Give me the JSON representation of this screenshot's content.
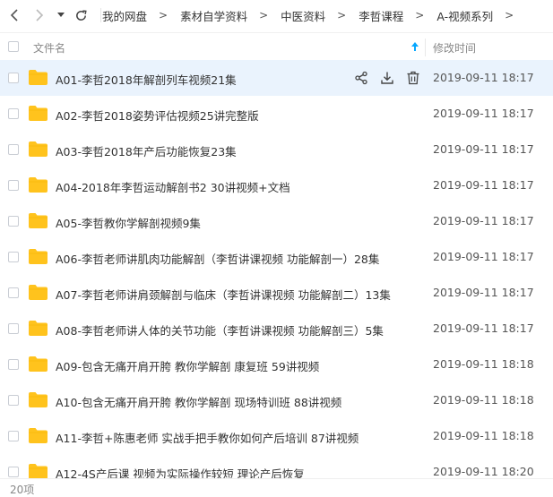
{
  "breadcrumb": [
    "我的网盘",
    "素材自学资料",
    "中医资料",
    "李哲课程",
    "A-视频系列"
  ],
  "breadcrumb_sep": ">",
  "columns": {
    "name": "文件名",
    "modified": "修改时间"
  },
  "files": [
    {
      "name": "A01-李哲2018年解剖列车视频21集",
      "modified": "2019-09-11 18:17"
    },
    {
      "name": "A02-李哲2018姿势评估视频25讲完整版",
      "modified": "2019-09-11 18:17"
    },
    {
      "name": "A03-李哲2018年产后功能恢复23集",
      "modified": "2019-09-11 18:17"
    },
    {
      "name": "A04-2018年李哲运动解剖书2 30讲视频+文档",
      "modified": "2019-09-11 18:17"
    },
    {
      "name": "A05-李哲教你学解剖视频9集",
      "modified": "2019-09-11 18:17"
    },
    {
      "name": "A06-李哲老师讲肌肉功能解剖（李哲讲课视频 功能解剖一）28集",
      "modified": "2019-09-11 18:17"
    },
    {
      "name": "A07-李哲老师讲肩颈解剖与临床（李哲讲课视频 功能解剖二）13集",
      "modified": "2019-09-11 18:17"
    },
    {
      "name": "A08-李哲老师讲人体的关节功能（李哲讲课视频 功能解剖三）5集",
      "modified": "2019-09-11 18:17"
    },
    {
      "name": "A09-包含无痛开肩开胯 教你学解剖 康复班 59讲视频",
      "modified": "2019-09-11 18:18"
    },
    {
      "name": "A10-包含无痛开肩开胯 教你学解剖 现场特训班 88讲视频",
      "modified": "2019-09-11 18:18"
    },
    {
      "name": "A11-李哲+陈惠老师 实战手把手教你如何产后培训 87讲视频",
      "modified": "2019-09-11 18:18"
    },
    {
      "name": "A12-4S产后课 视频为实际操作较短 理论产后恢复",
      "modified": "2019-09-11 18:20"
    }
  ],
  "item_count": "20项",
  "colors": {
    "accent": "#06a7ff",
    "folder": "#ffc31d",
    "selected_row": "#eaf3fd"
  }
}
